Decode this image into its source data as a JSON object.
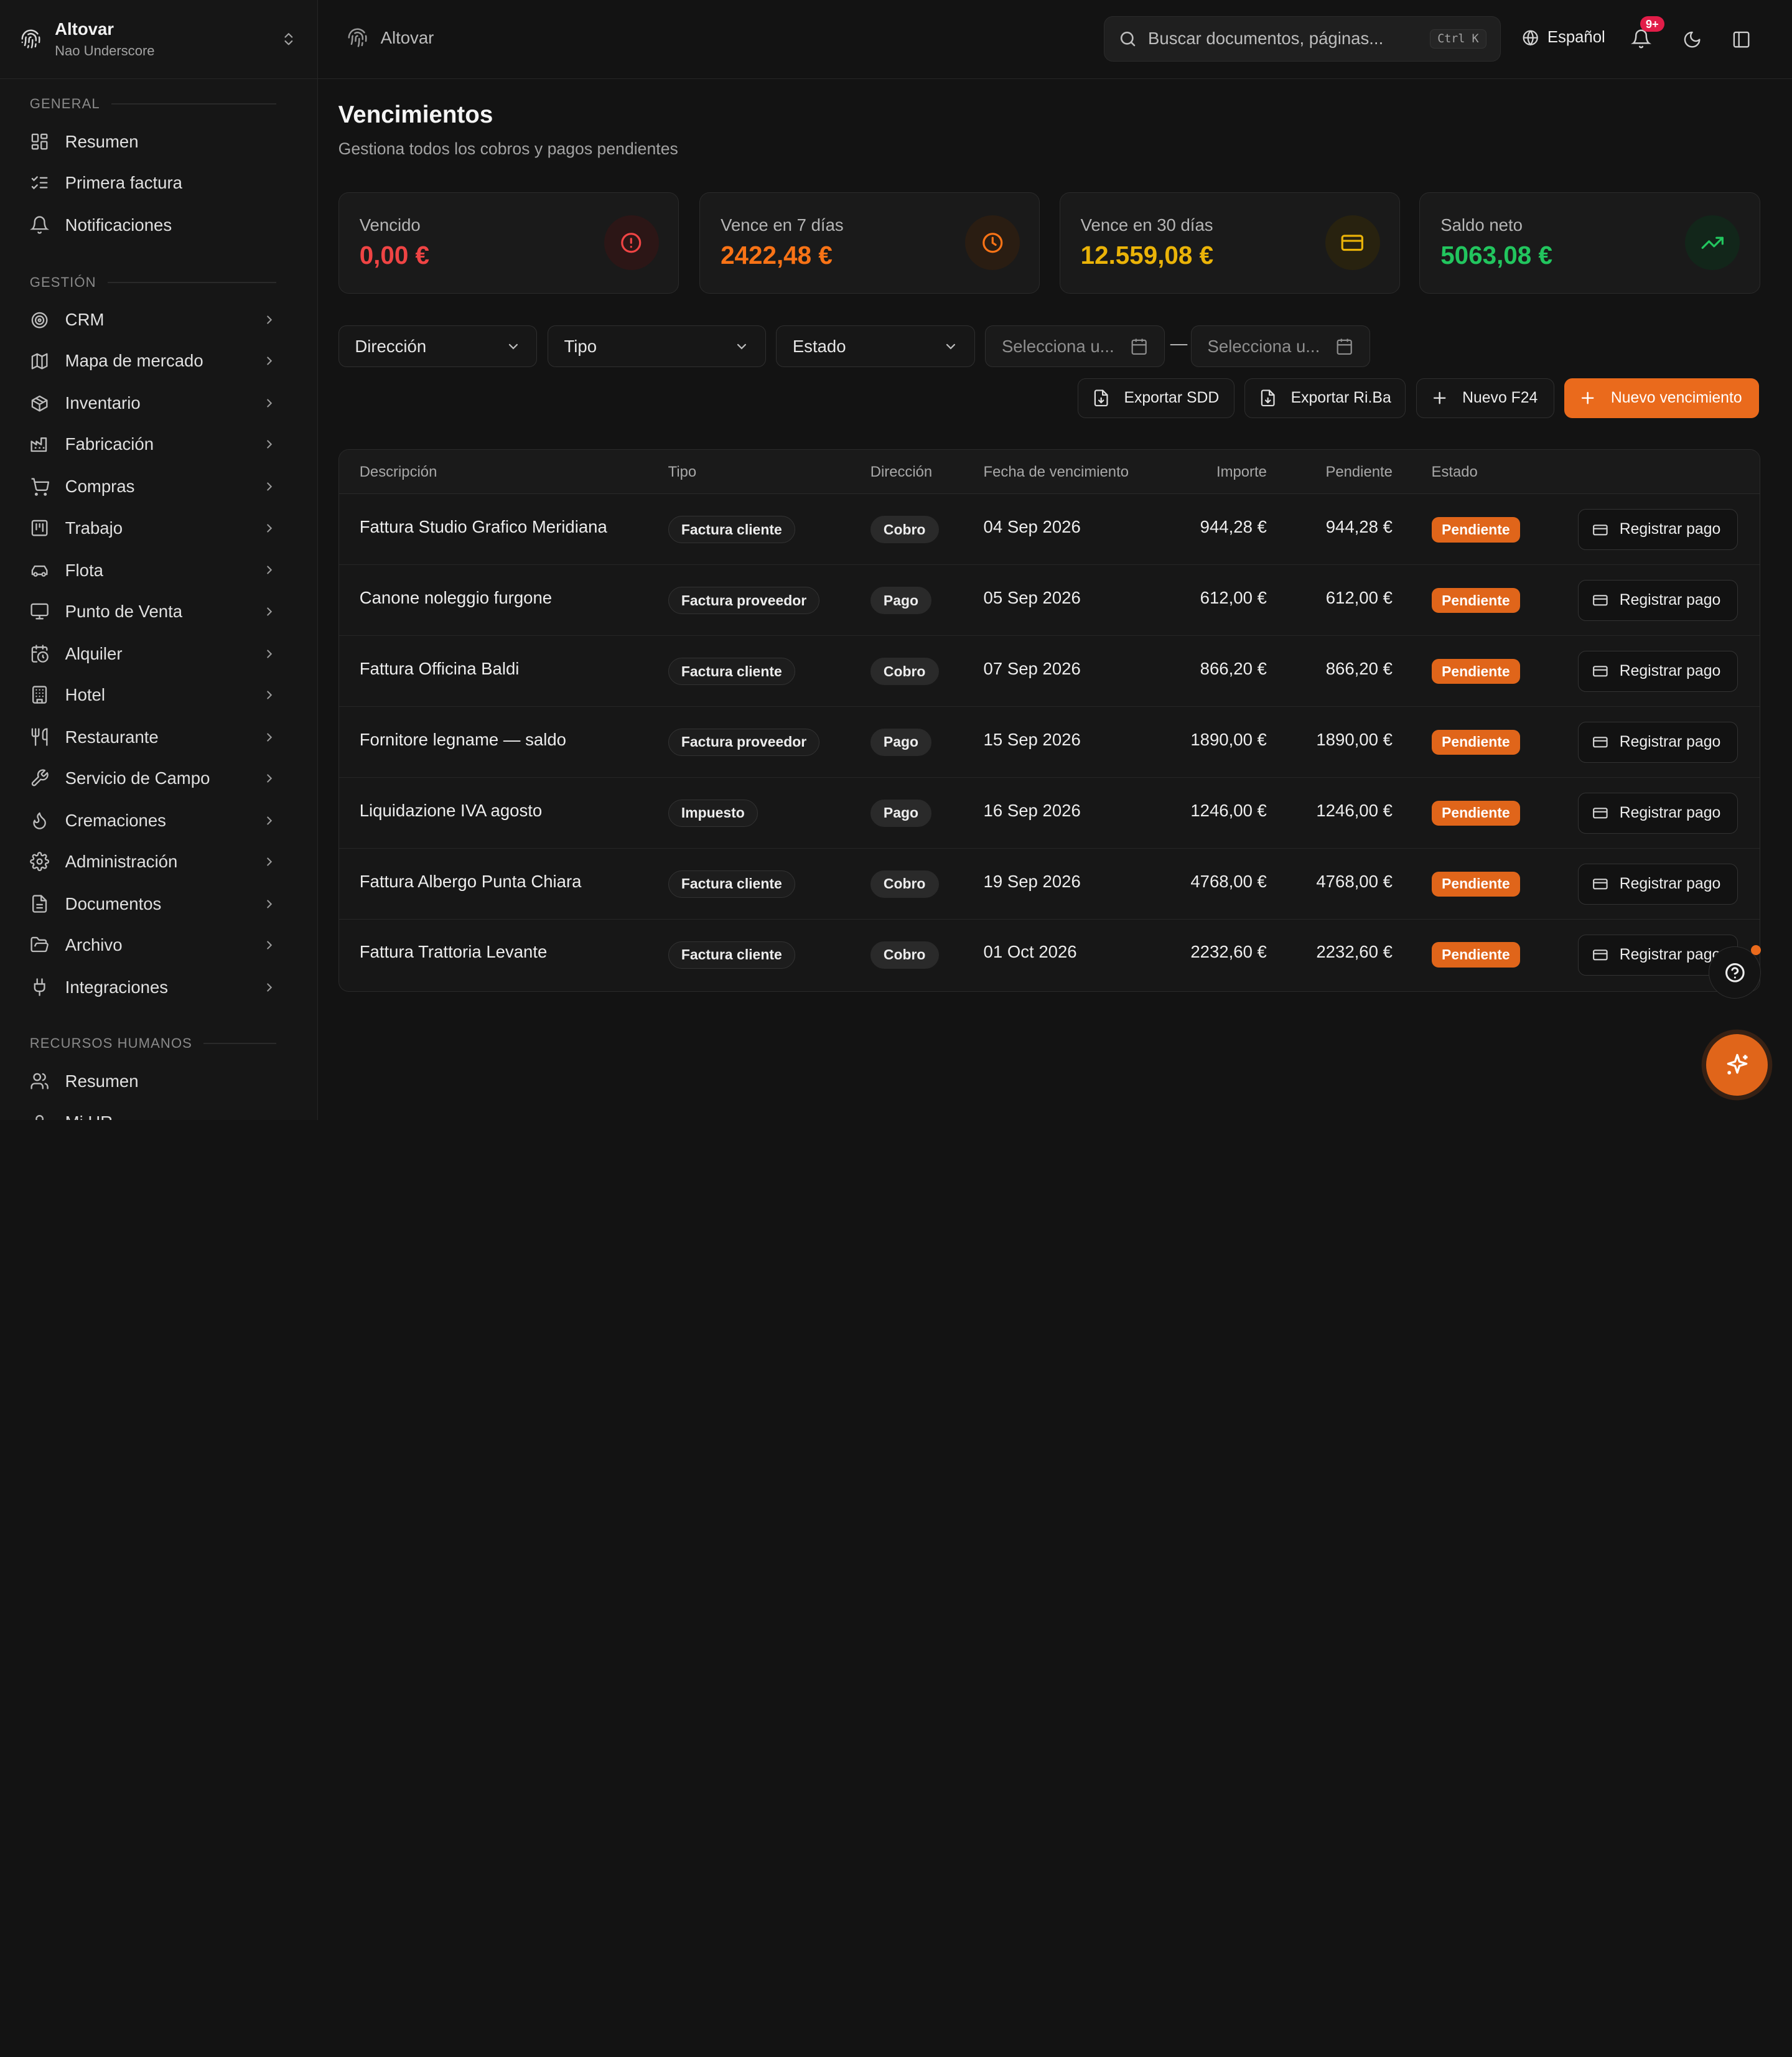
{
  "org": {
    "name": "Altovar",
    "user": "Nao Underscore"
  },
  "sidebar": {
    "sections": [
      {
        "label": "GENERAL"
      },
      {
        "label": "GESTIÓN"
      },
      {
        "label": "RECURSOS HUMANOS"
      }
    ],
    "items": [
      {
        "label": "Resumen",
        "icon": "dashboard-icon"
      },
      {
        "label": "Primera factura",
        "icon": "checklist-icon"
      },
      {
        "label": "Notificaciones",
        "icon": "bell-icon"
      },
      {
        "label": "CRM",
        "icon": "target-icon"
      },
      {
        "label": "Mapa de mercado",
        "icon": "map-icon"
      },
      {
        "label": "Inventario",
        "icon": "box-icon"
      },
      {
        "label": "Fabricación",
        "icon": "factory-icon"
      },
      {
        "label": "Compras",
        "icon": "cart-icon"
      },
      {
        "label": "Trabajo",
        "icon": "kanban-icon"
      },
      {
        "label": "Flota",
        "icon": "car-icon"
      },
      {
        "label": "Punto de Venta",
        "icon": "monitor-icon"
      },
      {
        "label": "Alquiler",
        "icon": "calendar-clock-icon"
      },
      {
        "label": "Hotel",
        "icon": "building-icon"
      },
      {
        "label": "Restaurante",
        "icon": "utensils-icon"
      },
      {
        "label": "Servicio de Campo",
        "icon": "wrench-icon"
      },
      {
        "label": "Cremaciones",
        "icon": "flame-icon"
      },
      {
        "label": "Administración",
        "icon": "gear-icon"
      },
      {
        "label": "Documentos",
        "icon": "file-icon"
      },
      {
        "label": "Archivo",
        "icon": "folder-open-icon"
      },
      {
        "label": "Integraciones",
        "icon": "plug-icon"
      },
      {
        "label": "Resumen",
        "icon": "users-icon"
      },
      {
        "label": "Mi HR",
        "icon": "user-icon"
      }
    ]
  },
  "topbar": {
    "breadcrumb": "Altovar",
    "search_placeholder": "Buscar documentos, páginas...",
    "shortcut": "Ctrl K",
    "language": "Español",
    "notifications_badge": "9+"
  },
  "page": {
    "title": "Vencimientos",
    "subtitle": "Gestiona todos los cobros y pagos pendientes"
  },
  "cards": [
    {
      "label": "Vencido",
      "value": "0,00 €",
      "color": "#ef4444",
      "icon": "alert-circle-icon"
    },
    {
      "label": "Vence en 7 días",
      "value": "2422,48 €",
      "color": "#f97316",
      "icon": "clock-icon"
    },
    {
      "label": "Vence en 30 días",
      "value": "12.559,08 €",
      "color": "#eab308",
      "icon": "credit-card-icon"
    },
    {
      "label": "Saldo neto",
      "value": "5063,08 €",
      "color": "#22c55e",
      "icon": "trending-up-icon"
    }
  ],
  "filters": {
    "direction": "Dirección",
    "type": "Tipo",
    "state": "Estado",
    "date_from": "Selecciona u...",
    "date_to": "Selecciona u...",
    "separator": "—"
  },
  "actions": {
    "export_sdd": "Exportar SDD",
    "export_riba": "Exportar Ri.Ba",
    "new_f24": "Nuevo F24",
    "new_due": "Nuevo vencimiento"
  },
  "table": {
    "headers": [
      "Descripción",
      "Tipo",
      "Dirección",
      "Fecha de vencimiento",
      "Importe",
      "Pendiente",
      "Estado"
    ],
    "pay_label": "Registrar pago",
    "rows": [
      {
        "desc": "Fattura Studio Grafico Meridiana",
        "type": "Factura cliente",
        "dir": "Cobro",
        "date": "04 Sep 2026",
        "amount": "944,28 €",
        "pending": "944,28 €",
        "status": "Pendiente"
      },
      {
        "desc": "Canone noleggio furgone",
        "type": "Factura proveedor",
        "dir": "Pago",
        "date": "05 Sep 2026",
        "amount": "612,00 €",
        "pending": "612,00 €",
        "status": "Pendiente"
      },
      {
        "desc": "Fattura Officina Baldi",
        "type": "Factura cliente",
        "dir": "Cobro",
        "date": "07 Sep 2026",
        "amount": "866,20 €",
        "pending": "866,20 €",
        "status": "Pendiente"
      },
      {
        "desc": "Fornitore legname — saldo",
        "type": "Factura proveedor",
        "dir": "Pago",
        "date": "15 Sep 2026",
        "amount": "1890,00 €",
        "pending": "1890,00 €",
        "status": "Pendiente"
      },
      {
        "desc": "Liquidazione IVA agosto",
        "type": "Impuesto",
        "dir": "Pago",
        "date": "16 Sep 2026",
        "amount": "1246,00 €",
        "pending": "1246,00 €",
        "status": "Pendiente"
      },
      {
        "desc": "Fattura Albergo Punta Chiara",
        "type": "Factura cliente",
        "dir": "Cobro",
        "date": "19 Sep 2026",
        "amount": "4768,00 €",
        "pending": "4768,00 €",
        "status": "Pendiente"
      },
      {
        "desc": "Fattura Trattoria Levante",
        "type": "Factura cliente",
        "dir": "Cobro",
        "date": "01 Oct 2026",
        "amount": "2232,60 €",
        "pending": "2232,60 €",
        "status": "Pendiente"
      }
    ]
  }
}
